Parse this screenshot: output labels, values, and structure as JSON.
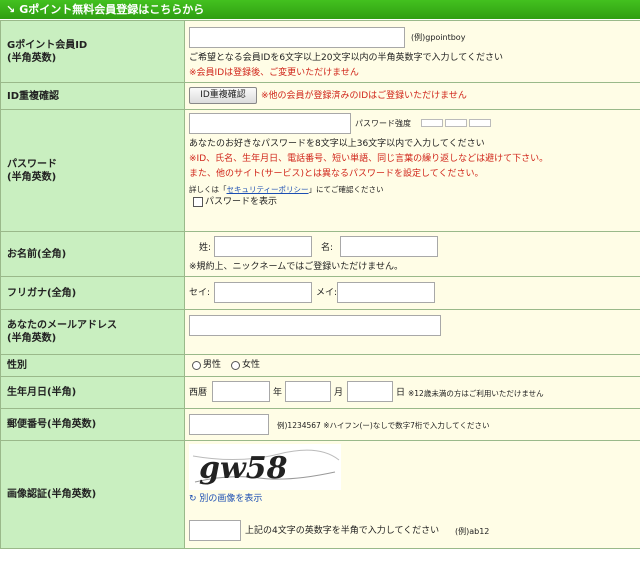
{
  "header": {
    "title": "Gポイント無料会員登録はこちらから",
    "mark": "↘"
  },
  "member_id": {
    "label": "Gポイント会員ID",
    "sub": "(半角英数)",
    "example": "(例)gpointboy",
    "note": "ご希望となる会員IDを6文字以上20文字以内の半角英数字で入力してください",
    "warning": "※会員IDは登録後、ご変更いただけません"
  },
  "id_check": {
    "label": "ID重複確認",
    "button": "ID重複確認",
    "warning": "※他の会員が登録済みのIDはご登録いただけません"
  },
  "password": {
    "label": "パスワード",
    "sub": "(半角英数)",
    "strength_label": "パスワード強度",
    "note": "あなたのお好きなパスワードを8文字以上36文字以内で入力してください",
    "warning1": "※ID、氏名、生年月日、電話番号、短い単語、同じ言葉の繰り返しなどは避けて下さい。",
    "warning2": "また、他のサイト(サービス)とは異なるパスワードを設定してください。",
    "policy_pre": "詳しくは「",
    "policy_link": "セキュリティーポリシー",
    "policy_post": "」にてご確認ください",
    "show_label": "パスワードを表示"
  },
  "name": {
    "label": "お名前(全角)",
    "sei": "姓:",
    "mei": "名:",
    "note": "※規約上、ニックネームではご登録いただけません。"
  },
  "kana": {
    "label": "フリガナ(全角)",
    "sei": "セイ:",
    "mei": "メイ:"
  },
  "email": {
    "label": "あなたのメールアドレス",
    "sub": "(半角英数)"
  },
  "gender": {
    "label": "性別",
    "male": "男性",
    "female": "女性"
  },
  "birth": {
    "label": "生年月日(半角)",
    "era": "西暦",
    "year": "年",
    "month": "月",
    "day": "日",
    "note": "※12歳未満の方はご利用いただけません"
  },
  "zip": {
    "label": "郵便番号(半角英数)",
    "note": "例)1234567 ※ハイフン(ー)なしで数字7桁で入力してください"
  },
  "captcha": {
    "label": "画像認証(半角英数)",
    "image_text": "gw58",
    "refresh": "別の画像を表示",
    "note": "上記の4文字の英数字を半角で入力してください",
    "example": "(例)ab12"
  },
  "colors": {
    "header_green": "#3aaf19",
    "label_green": "#c9efc0",
    "value_cream": "#fffde6",
    "warning_red": "#d0251a",
    "link_blue": "#1d4fb3"
  }
}
